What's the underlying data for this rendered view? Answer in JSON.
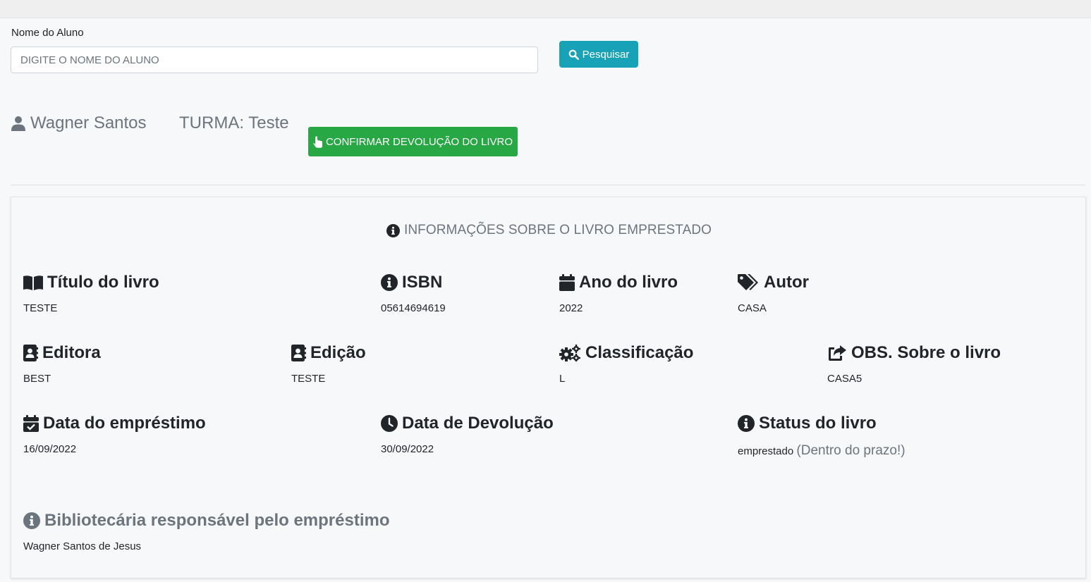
{
  "search": {
    "label": "Nome do Aluno",
    "placeholder": "DIGITE O NOME DO ALUNO",
    "value": "",
    "button_label": "Pesquisar",
    "button_icon": "search-icon"
  },
  "student": {
    "name": "Wagner Santos",
    "turma": "TURMA: Teste",
    "user_icon": "user-icon"
  },
  "confirm_button": {
    "label": "CONFIRMAR DEVOLUÇÃO DO LIVRO",
    "icon": "hand-pointer-icon"
  },
  "card": {
    "title": "INFORMAÇÕES SOBRE O LIVRO EMPRESTADO",
    "fields": {
      "titulo": {
        "label": "Título do livro",
        "value": "TESTE",
        "icon": "book-open-icon"
      },
      "isbn": {
        "label": "ISBN",
        "value": "05614694619",
        "icon": "info-circle-icon"
      },
      "ano": {
        "label": "Ano do livro",
        "value": "2022",
        "icon": "calendar-icon"
      },
      "autor": {
        "label": "Autor",
        "value": "CASA",
        "icon": "tags-icon"
      },
      "editora": {
        "label": "Editora",
        "value": "BEST",
        "icon": "address-book-icon"
      },
      "edicao": {
        "label": "Edição",
        "value": "TESTE",
        "icon": "address-book-icon"
      },
      "classificacao": {
        "label": "Classificação",
        "value": "L",
        "icon": "cogs-icon"
      },
      "obs": {
        "label": "OBS. Sobre o livro",
        "value": "CASA5",
        "icon": "share-square-icon"
      },
      "data_emprestimo": {
        "label": "Data do empréstimo",
        "value": "16/09/2022",
        "icon": "calendar-check-icon"
      },
      "data_devolucao": {
        "label": "Data de Devolução",
        "value": "30/09/2022",
        "icon": "clock-icon"
      },
      "status": {
        "label": "Status do livro",
        "value": "emprestado",
        "note": "(Dentro do prazo!)",
        "icon": "info-circle-icon"
      },
      "bibliotecaria": {
        "label": "Bibliotecária responsável pelo empréstimo",
        "value": "Wagner Santos de Jesus",
        "icon": "info-circle-icon"
      }
    }
  },
  "colors": {
    "search_button": "#17a2b8",
    "confirm_button": "#28a745",
    "muted_text": "#6c757d",
    "page_background": "#f7f8fa"
  }
}
